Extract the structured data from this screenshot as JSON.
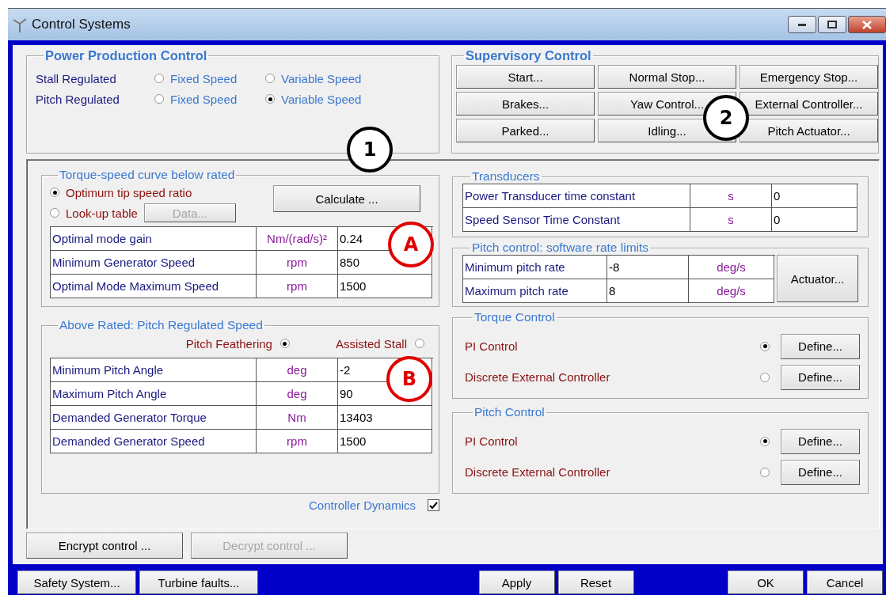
{
  "window": {
    "title": "Control Systems"
  },
  "power_production_control": {
    "title": "Power Production Control",
    "rows": [
      {
        "label": "Stall Regulated",
        "options": [
          {
            "label": "Fixed Speed",
            "selected": false
          },
          {
            "label": "Variable Speed",
            "selected": false
          }
        ]
      },
      {
        "label": "Pitch Regulated",
        "options": [
          {
            "label": "Fixed Speed",
            "selected": false
          },
          {
            "label": "Variable Speed",
            "selected": true
          }
        ]
      }
    ]
  },
  "supervisory_control": {
    "title": "Supervisory Control",
    "buttons": [
      "Start...",
      "Normal Stop...",
      "Emergency Stop...",
      "Brakes...",
      "Yaw Control...",
      "External Controller...",
      "Parked...",
      "Idling...",
      "Pitch Actuator..."
    ]
  },
  "torque_speed_curve": {
    "title": "Torque-speed curve below rated",
    "options": [
      {
        "label": "Optimum tip speed ratio",
        "selected": true
      },
      {
        "label": "Look-up table",
        "selected": false
      }
    ],
    "data_button": {
      "label": "Data...",
      "disabled": true
    },
    "calculate_button": "Calculate ...",
    "table": [
      {
        "name": "Optimal mode gain",
        "unit": "Nm/(rad/s)²",
        "value": "0.24"
      },
      {
        "name": "Minimum Generator Speed",
        "unit": "rpm",
        "value": "850"
      },
      {
        "name": "Optimal Mode Maximum Speed",
        "unit": "rpm",
        "value": "1500"
      }
    ]
  },
  "above_rated": {
    "title": "Above Rated: Pitch Regulated Speed",
    "options": [
      {
        "label": "Pitch Feathering",
        "selected": true
      },
      {
        "label": "Assisted Stall",
        "selected": false
      }
    ],
    "table": [
      {
        "name": "Minimum Pitch Angle",
        "unit": "deg",
        "value": "-2"
      },
      {
        "name": "Maximum Pitch Angle",
        "unit": "deg",
        "value": "90"
      },
      {
        "name": "Demanded Generator Torque",
        "unit": "Nm",
        "value": "13403"
      },
      {
        "name": "Demanded Generator Speed",
        "unit": "rpm",
        "value": "1500"
      }
    ]
  },
  "controller_dynamics": {
    "label": "Controller Dynamics",
    "checked": true
  },
  "transducers": {
    "title": "Transducers",
    "table": [
      {
        "name": "Power Transducer time constant",
        "unit": "s",
        "value": "0"
      },
      {
        "name": "Speed Sensor Time Constant",
        "unit": "s",
        "value": "0"
      }
    ]
  },
  "pitch_rate_limits": {
    "title": "Pitch control: software rate limits",
    "table": [
      {
        "name": "Minimum pitch rate",
        "value": "-8",
        "unit": "deg/s"
      },
      {
        "name": "Maximum pitch rate",
        "value": "8",
        "unit": "deg/s"
      }
    ],
    "button": "Actuator..."
  },
  "torque_control": {
    "title": "Torque Control",
    "options": [
      {
        "label": "PI Control",
        "selected": true,
        "button": "Define..."
      },
      {
        "label": "Discrete External Controller",
        "selected": false,
        "button": "Define..."
      }
    ]
  },
  "pitch_control": {
    "title": "Pitch Control",
    "options": [
      {
        "label": "PI Control",
        "selected": true,
        "button": "Define..."
      },
      {
        "label": "Discrete External Controller",
        "selected": false,
        "button": "Define..."
      }
    ]
  },
  "encrypt_buttons": [
    {
      "label": "Encrypt control ...",
      "disabled": false
    },
    {
      "label": "Decrypt control ...",
      "disabled": true
    }
  ],
  "footer_buttons": {
    "left": [
      "Safety System...",
      "Turbine faults..."
    ],
    "middle": [
      "Apply",
      "Reset"
    ],
    "right": [
      "OK",
      "Cancel"
    ]
  },
  "annotations": [
    {
      "label": "1",
      "color": "#000000"
    },
    {
      "label": "2",
      "color": "#000000"
    },
    {
      "label": "A",
      "color": "#e00000"
    },
    {
      "label": "B",
      "color": "#e00000"
    }
  ]
}
